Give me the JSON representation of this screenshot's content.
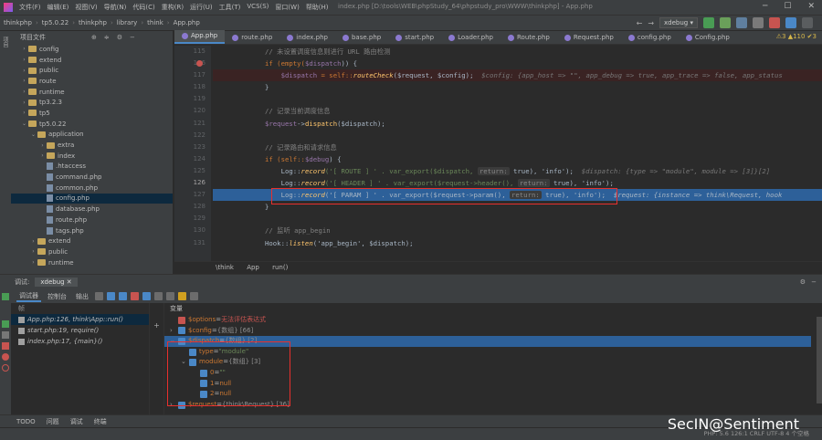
{
  "menu": [
    "文件(F)",
    "编辑(E)",
    "视图(V)",
    "导航(N)",
    "代码(C)",
    "重构(R)",
    "运行(U)",
    "工具(T)",
    "VCS(S)",
    "窗口(W)",
    "帮助(H)"
  ],
  "window_title": "index.php [D:\\tools\\WEB\\phpStudy_64\\phpstudy_pro\\WWW\\thinkphp] - App.php",
  "nav_crumbs": [
    "thinkphp",
    "tp5.0.22",
    "thinkphp",
    "library",
    "think",
    "App.php"
  ],
  "run_config": "xdebug",
  "project": {
    "header": "项目文件",
    "tree": [
      {
        "indent": 1,
        "type": "folder",
        "expanded": false,
        "label": "config"
      },
      {
        "indent": 1,
        "type": "folder",
        "expanded": false,
        "label": "extend"
      },
      {
        "indent": 1,
        "type": "folder",
        "expanded": false,
        "label": "public"
      },
      {
        "indent": 1,
        "type": "folder",
        "expanded": false,
        "label": "route"
      },
      {
        "indent": 1,
        "type": "folder",
        "expanded": false,
        "label": "runtime"
      },
      {
        "indent": 1,
        "type": "folder",
        "expanded": false,
        "label": "tp3.2.3"
      },
      {
        "indent": 1,
        "type": "folder",
        "expanded": false,
        "label": "tp5"
      },
      {
        "indent": 1,
        "type": "folder",
        "expanded": true,
        "label": "tp5.0.22"
      },
      {
        "indent": 2,
        "type": "folder",
        "expanded": true,
        "label": "application"
      },
      {
        "indent": 3,
        "type": "folder",
        "expanded": false,
        "label": "extra"
      },
      {
        "indent": 3,
        "type": "folder",
        "expanded": false,
        "label": "index"
      },
      {
        "indent": 3,
        "type": "file",
        "label": ".htaccess"
      },
      {
        "indent": 3,
        "type": "file",
        "label": "command.php"
      },
      {
        "indent": 3,
        "type": "file",
        "label": "common.php"
      },
      {
        "indent": 3,
        "type": "file",
        "label": "config.php",
        "selected": true
      },
      {
        "indent": 3,
        "type": "file",
        "label": "database.php"
      },
      {
        "indent": 3,
        "type": "file",
        "label": "route.php"
      },
      {
        "indent": 3,
        "type": "file",
        "label": "tags.php"
      },
      {
        "indent": 2,
        "type": "folder",
        "expanded": false,
        "label": "extend"
      },
      {
        "indent": 2,
        "type": "folder",
        "expanded": false,
        "label": "public"
      },
      {
        "indent": 2,
        "type": "folder",
        "expanded": false,
        "label": "runtime"
      }
    ]
  },
  "tabs": [
    "App.php",
    "route.php",
    "index.php",
    "base.php",
    "start.php",
    "Loader.php",
    "Route.php",
    "Request.php",
    "config.php",
    "Config.php"
  ],
  "inspections": "⚠3  ▲110  ✔3",
  "gutter_lines": [
    {
      "n": "115"
    },
    {
      "n": "116",
      "bp": true
    },
    {
      "n": "117"
    },
    {
      "n": "118"
    },
    {
      "n": "119"
    },
    {
      "n": "120"
    },
    {
      "n": "121"
    },
    {
      "n": "122"
    },
    {
      "n": "123"
    },
    {
      "n": "124"
    },
    {
      "n": "125"
    },
    {
      "n": "126",
      "current": true
    },
    {
      "n": "127"
    },
    {
      "n": "128"
    },
    {
      "n": "129"
    },
    {
      "n": "130"
    },
    {
      "n": "131"
    }
  ],
  "code": {
    "l115": "// 未设置调度信息则进行 URL 路由检测",
    "l116a": "if (empty(",
    "l116b": "$dispatch",
    "l116c": ")) {",
    "l117a": "    $dispatch",
    "l117b": " = self::",
    "l117c": "routeCheck",
    "l117d": "($request, $config);",
    "l117hint": "  $config: {app_host => \"\", app_debug => true, app_trace => false, app_status",
    "l118": "}",
    "l120": "// 记录当前调度信息",
    "l121a": "$request",
    "l121b": "->",
    "l121c": "dispatch",
    "l121d": "($dispatch);",
    "l123": "// 记录路由和请求信息",
    "l124a": "if (self::",
    "l124b": "$debug",
    "l124c": ") {",
    "l125a": "    Log::",
    "l125b": "record",
    "l125c": "('[ ROUTE ] ' . var_export($dispatch, ",
    "l125i": "return:",
    "l125d": " true), 'info');",
    "l125hint": "  $dispatch: {type => \"module\", module => [3]}[2]",
    "l126a": "    Log::",
    "l126b": "record",
    "l126c": "('[ HEADER ] ' . var_export($request->header(), ",
    "l126i": "return:",
    "l126d": " true), 'info');",
    "l127a": "    Log::",
    "l127b": "record",
    "l127c": "('[ PARAM ] ' . var_export($request->param(), ",
    "l127i": "return:",
    "l127d": " true), 'info');",
    "l127hint": "  $request: {instance => think\\Request, hook",
    "l128": "}",
    "l130": "// 监听 app_begin",
    "l131a": "Hook::",
    "l131b": "listen",
    "l131c": "('app_begin', $dispatch);"
  },
  "editor_breadcrumb": "\\think    App    run()",
  "debug": {
    "label": "调试:",
    "session_tab": "xdebug",
    "tool_tabs": [
      "调试器",
      "控制台",
      "输出"
    ],
    "frames_header": "帧",
    "frames": [
      {
        "text": "App.php:126, think\\App::run()",
        "selected": true
      },
      {
        "text": "start.php:19, require()"
      },
      {
        "text": "index.php:17, {main}()"
      }
    ],
    "vars_header": "变量",
    "vars": [
      {
        "indent": 0,
        "name": "$options",
        "eq": " = ",
        "value": "无法评估表达式",
        "kind": "error"
      },
      {
        "indent": 0,
        "name": "$config",
        "eq": " = ",
        "value": "{数组} [66]",
        "kind": "type",
        "arrow": "›"
      },
      {
        "indent": 0,
        "name": "$dispatch",
        "eq": " = ",
        "value": "{数组} [2]",
        "kind": "type",
        "arrow": "⌄",
        "selected": true
      },
      {
        "indent": 1,
        "name": "type",
        "eq": " = ",
        "value": "\"module\"",
        "kind": "str"
      },
      {
        "indent": 1,
        "name": "module",
        "eq": " = ",
        "value": "{数组} [3]",
        "kind": "type",
        "arrow": "⌄"
      },
      {
        "indent": 2,
        "name": "0",
        "eq": " = ",
        "value": "\"\"",
        "kind": "str"
      },
      {
        "indent": 2,
        "name": "1",
        "eq": " = ",
        "value": "null",
        "kind": "kw"
      },
      {
        "indent": 2,
        "name": "2",
        "eq": " = ",
        "value": "null",
        "kind": "kw"
      },
      {
        "indent": 0,
        "name": "$request",
        "eq": " = ",
        "value": "{think\\Request} [36]",
        "kind": "type",
        "arrow": "›"
      }
    ]
  },
  "bottom_tools": [
    "TODO",
    "问题",
    "调试",
    "终端"
  ],
  "status": "PHP: 5.6   126:1   CRLF   UTF-8   4 个空格   ",
  "watermark": "SecIN@Sentiment"
}
